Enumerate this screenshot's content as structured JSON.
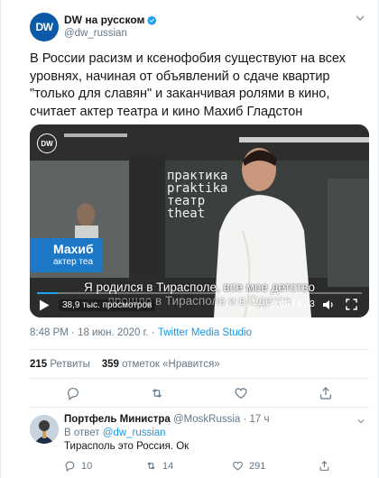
{
  "account": {
    "display_name": "DW на русском",
    "handle": "@dw_russian",
    "avatar_text": "DW"
  },
  "tweet": {
    "text": "В России расизм и ксенофобия существуют на всех уровнях, начиная от объявлений о сдаче квартир \"только для славян\" и заканчивая ролями в кино, считает актер театра и кино Махиб Гладстон",
    "timestamp": "8:48 PM · 18 июн. 2020 г. · ",
    "source": "Twitter Media Studio"
  },
  "video": {
    "badge_text": "DW",
    "wall_text": [
      "практика",
      "praktika",
      "театр",
      "theat"
    ],
    "name_tag_line1": "Махиб",
    "name_tag_line2": "актер теа",
    "subtitle_line1": "Я родился в Тирасполе, все мое детство",
    "subtitle_line2": "прошло в Тирасполе и в Одессе",
    "views": "38,9 тыс. просмотров",
    "current_time": "0:06",
    "duration": " / 1:33",
    "progress": 0.065
  },
  "stats": {
    "retweets_count": "215",
    "retweets_label": " Ретвиты",
    "likes_count": "359",
    "likes_label": " отметок «Нравится»"
  },
  "reply": {
    "name": "Портфель Министра",
    "handle": " @MoskRussia · 17 ч",
    "in_reply_prefix": "В ответ ",
    "in_reply_handle": "@dw_russian",
    "text": "Тирасполь это Россия. Ок",
    "reply_count": "10",
    "retweet_count": "14",
    "like_count": "291"
  },
  "colors": {
    "accent": "#1b95e0",
    "muted": "#657786",
    "brand_blue": "#1e78c8"
  }
}
